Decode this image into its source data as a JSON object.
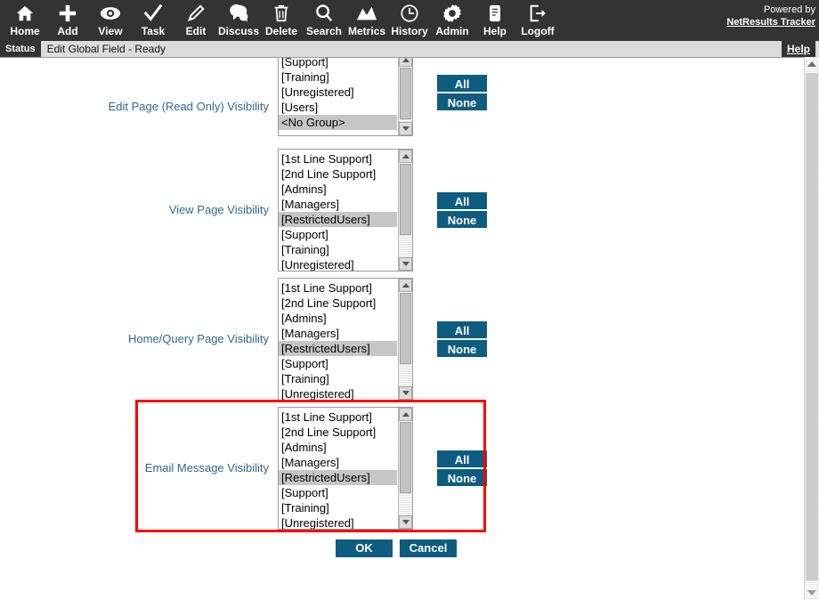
{
  "toolbar": {
    "items": [
      {
        "label": "Home",
        "icon": "home-icon"
      },
      {
        "label": "Add",
        "icon": "plus-icon"
      },
      {
        "label": "View",
        "icon": "eye-icon"
      },
      {
        "label": "Task",
        "icon": "check-icon"
      },
      {
        "label": "Edit",
        "icon": "pencil-icon"
      },
      {
        "label": "Discuss",
        "icon": "speech-bubbles-icon"
      },
      {
        "label": "Delete",
        "icon": "trash-icon"
      },
      {
        "label": "Search",
        "icon": "magnifier-icon"
      },
      {
        "label": "Metrics",
        "icon": "chart-icon"
      },
      {
        "label": "History",
        "icon": "clock-icon"
      },
      {
        "label": "Admin",
        "icon": "gear-icon"
      },
      {
        "label": "Help",
        "icon": "document-icon"
      },
      {
        "label": "Logoff",
        "icon": "logout-icon"
      }
    ],
    "brand_prefix": "Powered by",
    "brand_name": "NetResults Tracker"
  },
  "statusbar": {
    "tag": "Status",
    "message": "Edit Global Field - Ready",
    "help_label": "Help"
  },
  "buttons": {
    "all_label": "All",
    "none_label": "None",
    "ok_label": "OK",
    "cancel_label": "Cancel"
  },
  "colors": {
    "toolbar_bg": "#333333",
    "label_text": "#31688e",
    "button_bg": "#0e5c80",
    "highlight_border": "#ff0000",
    "selection_bg": "#c6c6c6"
  },
  "rows": [
    {
      "label": "Edit Page (Read Only) Visibility",
      "options": [
        "[Support]",
        "[Training]",
        "[Unregistered]",
        "[Users]",
        "<No Group>"
      ],
      "selected": [
        "<No Group>"
      ],
      "scroll_position": "bottom",
      "clipped_top": true
    },
    {
      "label": "View Page Visibility",
      "options": [
        "[1st Line Support]",
        "[2nd Line Support]",
        "[Admins]",
        "[Managers]",
        "[RestrictedUsers]",
        "[Support]",
        "[Training]",
        "[Unregistered]"
      ],
      "selected": [
        "[RestrictedUsers]"
      ],
      "scroll_position": "top",
      "clipped_top": false
    },
    {
      "label": "Home/Query Page Visibility",
      "options": [
        "[1st Line Support]",
        "[2nd Line Support]",
        "[Admins]",
        "[Managers]",
        "[RestrictedUsers]",
        "[Support]",
        "[Training]",
        "[Unregistered]"
      ],
      "selected": [
        "[RestrictedUsers]"
      ],
      "scroll_position": "top",
      "clipped_top": false
    },
    {
      "label": "Email Message Visibility",
      "options": [
        "[1st Line Support]",
        "[2nd Line Support]",
        "[Admins]",
        "[Managers]",
        "[RestrictedUsers]",
        "[Support]",
        "[Training]",
        "[Unregistered]"
      ],
      "selected": [
        "[RestrictedUsers]"
      ],
      "scroll_position": "top",
      "clipped_top": false,
      "highlighted": true
    }
  ]
}
